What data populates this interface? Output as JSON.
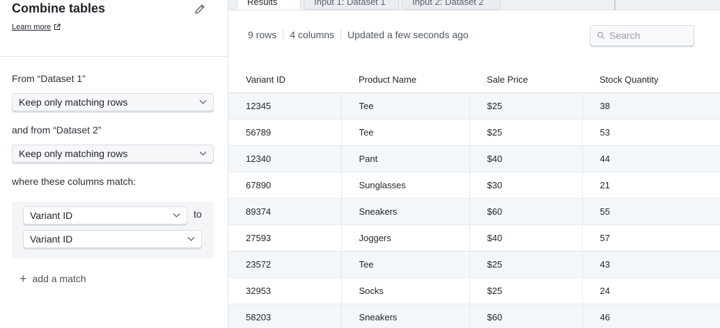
{
  "panel": {
    "title": "Combine tables",
    "learn_more": "Learn more",
    "from1_label": "From “Dataset 1”",
    "from1_value": "Keep only matching rows",
    "from2_label": "and from “Dataset 2”",
    "from2_value": "Keep only matching rows",
    "match_label": "where these columns match:",
    "match_left": "Variant ID",
    "match_to": "to",
    "match_right": "Variant ID",
    "add_match": "add a match"
  },
  "tabs": [
    {
      "label": "Results"
    },
    {
      "label": "Input 1: Dataset 1"
    },
    {
      "label": "Input 2: Dataset 2"
    }
  ],
  "info": {
    "rows": "9 rows",
    "columns": "4 columns",
    "updated": "Updated a few seconds ago"
  },
  "search": {
    "placeholder": "Search"
  },
  "table": {
    "headers": [
      "Variant ID",
      "Product Name",
      "Sale Price",
      "Stock Quantity"
    ],
    "rows": [
      [
        "12345",
        "Tee",
        "$25",
        "38"
      ],
      [
        "56789",
        "Tee",
        "$25",
        "53"
      ],
      [
        "12340",
        "Pant",
        "$40",
        "44"
      ],
      [
        "67890",
        "Sunglasses",
        "$30",
        "21"
      ],
      [
        "89374",
        "Sneakers",
        "$60",
        "55"
      ],
      [
        "27593",
        "Joggers",
        "$40",
        "57"
      ],
      [
        "23572",
        "Tee",
        "$25",
        "43"
      ],
      [
        "32953",
        "Socks",
        "$25",
        "24"
      ],
      [
        "58203",
        "Sneakers",
        "$60",
        "46"
      ]
    ]
  }
}
